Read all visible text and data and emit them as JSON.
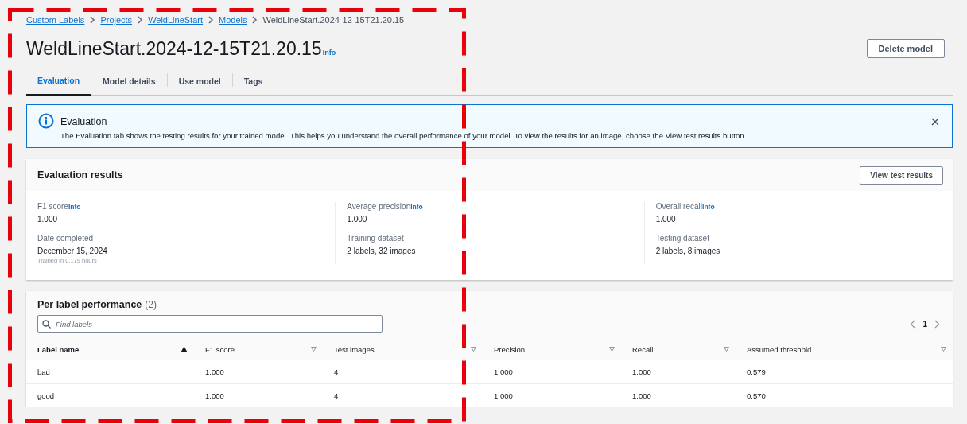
{
  "breadcrumbs": [
    {
      "label": "Custom Labels",
      "link": true
    },
    {
      "label": "Projects",
      "link": true
    },
    {
      "label": "WeldLineStart",
      "link": true
    },
    {
      "label": "Models",
      "link": true
    },
    {
      "label": "WeldLineStart.2024-12-15T21.20.15",
      "link": false
    }
  ],
  "header": {
    "title": "WeldLineStart.2024-12-15T21.20.15",
    "info": "Info",
    "action": "Delete model"
  },
  "tabs": [
    {
      "label": "Evaluation",
      "selected": true
    },
    {
      "label": "Model details",
      "selected": false
    },
    {
      "label": "Use model",
      "selected": false
    },
    {
      "label": "Tags",
      "selected": false
    }
  ],
  "alert": {
    "title": "Evaluation",
    "message": "The Evaluation tab shows the testing results for your trained model. This helps you understand the overall performance of your model. To view the results for an image, choose the View test results button.",
    "dismissible": true
  },
  "evaluation_results": {
    "title": "Evaluation results",
    "button": "View test results",
    "columns": [
      [
        {
          "label": "F1 score",
          "info": "Info",
          "value": "1.000"
        },
        {
          "label": "Date completed",
          "value": "December 15, 2024",
          "note": "Trained in 0.179 hours"
        }
      ],
      [
        {
          "label": "Average precision",
          "info": "Info",
          "value": "1.000"
        },
        {
          "label": "Training dataset",
          "value": "2 labels, 32 images"
        }
      ],
      [
        {
          "label": "Overall recall",
          "info": "Info",
          "value": "1.000"
        },
        {
          "label": "Testing dataset",
          "value": "2 labels, 8 images"
        }
      ]
    ]
  },
  "per_label": {
    "title": "Per label performance",
    "count": "(2)",
    "search": {
      "placeholder": "Find labels"
    },
    "pagination": {
      "page": "1"
    },
    "columns": [
      {
        "label": "Label name",
        "sorted": true
      },
      {
        "label": "F1 score",
        "sorted": false
      },
      {
        "label": "Test images",
        "sorted": false
      },
      {
        "label": "Precision",
        "sorted": false
      },
      {
        "label": "Recall",
        "sorted": false
      },
      {
        "label": "Assumed threshold",
        "sorted": false
      }
    ],
    "rows": [
      [
        "bad",
        "1.000",
        "4",
        "1.000",
        "1.000",
        "0.579"
      ],
      [
        "good",
        "1.000",
        "4",
        "1.000",
        "1.000",
        "0.570"
      ]
    ]
  },
  "annotation": {
    "kind": "dashed-frame"
  }
}
